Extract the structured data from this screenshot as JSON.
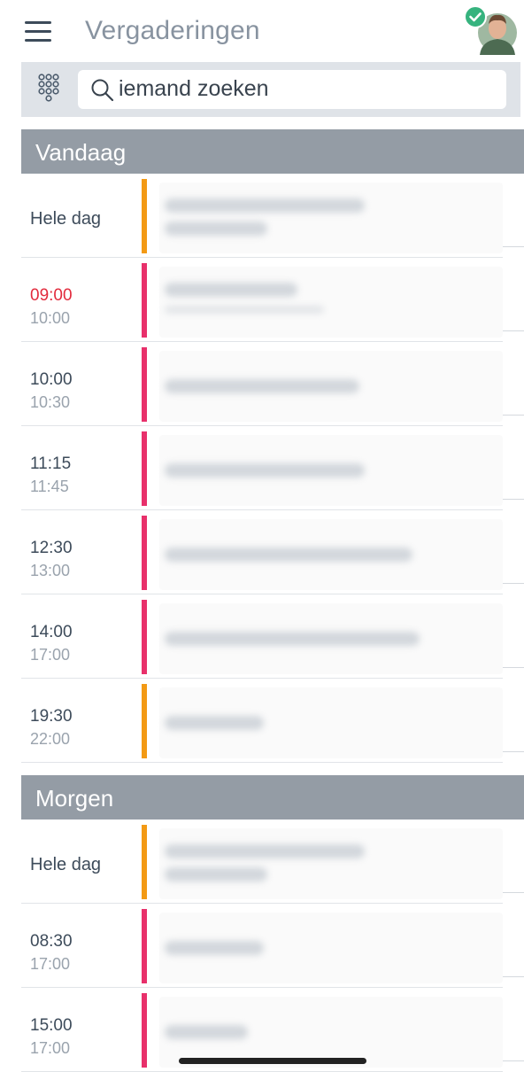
{
  "header": {
    "title": "Vergaderingen",
    "status_color": "#36b37e"
  },
  "search": {
    "text": "iemand zoeken"
  },
  "colors": {
    "orange": "#f39a14",
    "pink": "#e8306b",
    "now": "#e22b3d",
    "section_bg": "#949ca5"
  },
  "sections": [
    {
      "label": "Vandaag",
      "events": [
        {
          "start": "Hele dag",
          "end": "",
          "color": "orange",
          "allday": true
        },
        {
          "start": "09:00",
          "end": "10:00",
          "color": "pink",
          "now": true
        },
        {
          "start": "10:00",
          "end": "10:30",
          "color": "pink"
        },
        {
          "start": "11:15",
          "end": "11:45",
          "color": "pink"
        },
        {
          "start": "12:30",
          "end": "13:00",
          "color": "pink"
        },
        {
          "start": "14:00",
          "end": "17:00",
          "color": "pink"
        },
        {
          "start": "19:30",
          "end": "22:00",
          "color": "orange"
        }
      ]
    },
    {
      "label": "Morgen",
      "events": [
        {
          "start": "Hele dag",
          "end": "",
          "color": "orange",
          "allday": true
        },
        {
          "start": "08:30",
          "end": "17:00",
          "color": "pink"
        },
        {
          "start": "15:00",
          "end": "17:00",
          "color": "pink"
        }
      ]
    }
  ]
}
